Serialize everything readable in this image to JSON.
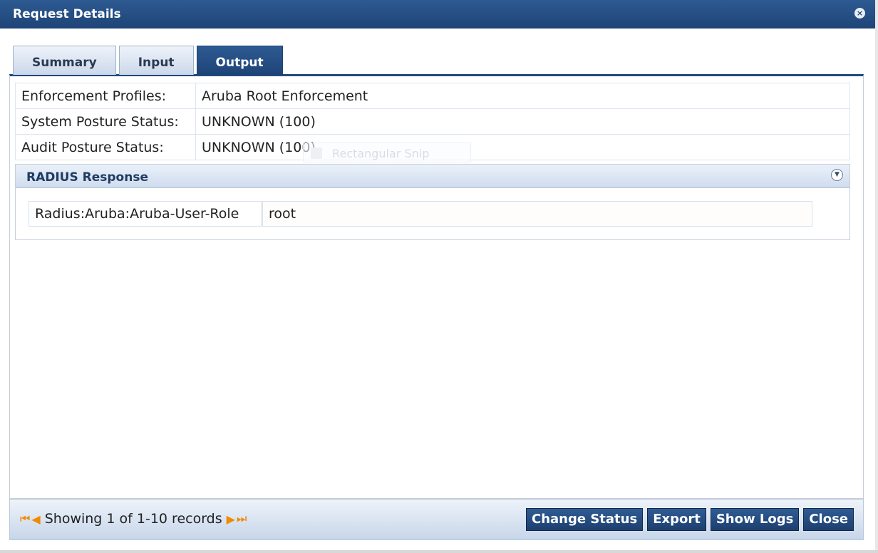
{
  "window": {
    "title": "Request Details",
    "close_glyph": "×"
  },
  "tabs": [
    {
      "label": "Summary",
      "active": false
    },
    {
      "label": "Input",
      "active": false
    },
    {
      "label": "Output",
      "active": true
    }
  ],
  "details": [
    {
      "label": "Enforcement Profiles:",
      "value": "Aruba Root Enforcement"
    },
    {
      "label": "System Posture Status:",
      "value": "UNKNOWN (100)"
    },
    {
      "label": "Audit Posture Status:",
      "value": "UNKNOWN (100)"
    }
  ],
  "radius_panel": {
    "title": "RADIUS Response",
    "collapse_glyph": "▼",
    "rows": [
      {
        "attribute": "Radius:Aruba:Aruba-User-Role",
        "value": "root"
      }
    ]
  },
  "overlay": {
    "text": "Rectangular Snip"
  },
  "footer": {
    "pager_first": "⏮",
    "pager_prev": "◀",
    "pager_text": "Showing 1 of 1-10 records",
    "pager_next": "▶",
    "pager_last": "⏭",
    "buttons": {
      "change_status": "Change Status",
      "export": "Export",
      "show_logs": "Show Logs",
      "close": "Close"
    }
  },
  "colors": {
    "header": "#1e4477",
    "accent_orange": "#f08a00"
  }
}
